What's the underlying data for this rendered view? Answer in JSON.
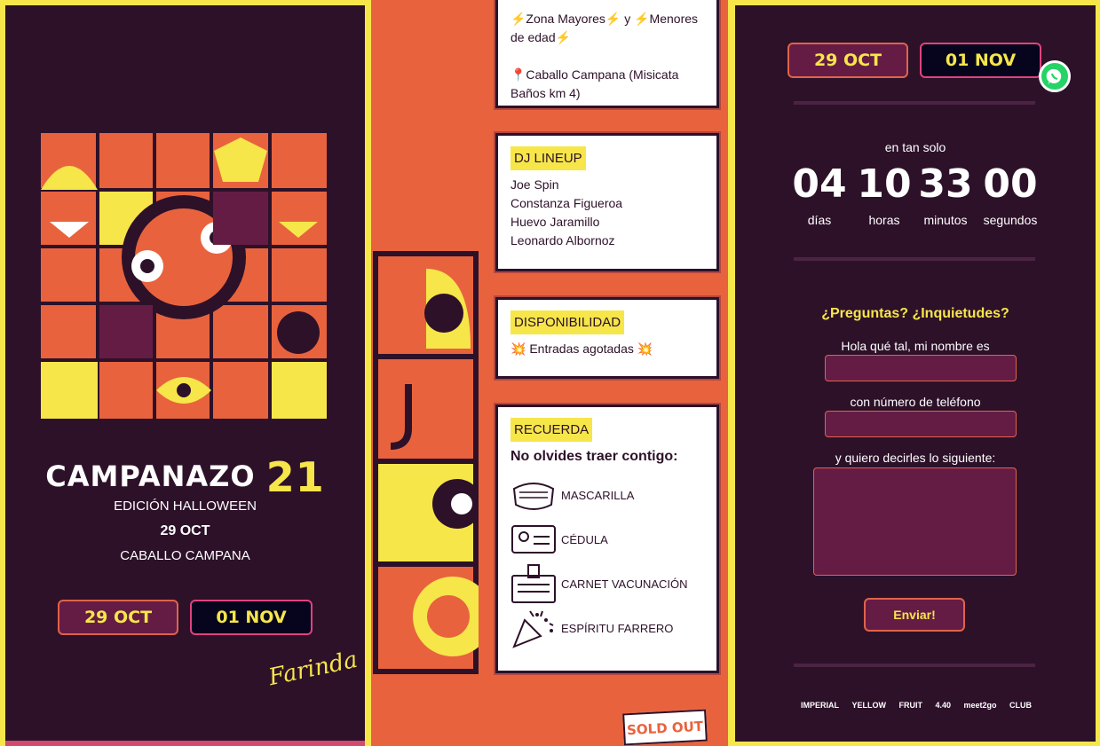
{
  "left": {
    "event_name": "CAMPANAZO",
    "event_number": "21",
    "edition": "EDICIÓN HALLOWEEN",
    "date": "29 OCT",
    "place": "CABALLO CAMPANA",
    "date_buttons": [
      "29 OCT",
      "01 NOV"
    ],
    "signature": "Farinda"
  },
  "info": {
    "zone_text": "⚡Zona Mayores⚡ y ⚡Menores de edad⚡",
    "location_text": "📍Caballo Campana (Misicata Baños km 4)"
  },
  "lineup": {
    "tag": "DJ LINEUP",
    "djs": [
      "Joe Spin",
      "Constanza Figueroa",
      "Huevo Jaramillo",
      "Leonardo Albornoz"
    ]
  },
  "availability": {
    "tag": "DISPONIBILIDAD",
    "text": "💥 Entradas agotadas 💥"
  },
  "reminder": {
    "tag": "RECUERDA",
    "title": "No olvides traer contigo:",
    "items": [
      {
        "label": "MASCARILLA",
        "icon": "mask-icon"
      },
      {
        "label": "CÉDULA",
        "icon": "id-card-icon"
      },
      {
        "label": "CARNET VACUNACIÓN",
        "icon": "vaccination-card-icon"
      },
      {
        "label": "ESPÍRITU FARRERO",
        "icon": "party-popper-icon"
      }
    ]
  },
  "soldout": "SOLD OUT",
  "right": {
    "date_buttons": [
      "29 OCT",
      "01 NOV"
    ],
    "countdown_intro": "en tan solo",
    "countdown": [
      {
        "value": "04",
        "unit": "días"
      },
      {
        "value": "10",
        "unit": "horas"
      },
      {
        "value": "33",
        "unit": "minutos"
      },
      {
        "value": "00",
        "unit": "segundos"
      }
    ],
    "form": {
      "title": "¿Preguntas? ¿Inquietudes?",
      "name_label": "Hola qué tal, mi nombre es",
      "phone_label": "con número de teléfono",
      "message_label": "y quiero decirles lo siguiente:",
      "submit": "Enviar!"
    },
    "sponsors": [
      "IMPERIAL",
      "YELLOW",
      "FRUIT",
      "4.40",
      "meet2go",
      "CLUB"
    ]
  },
  "colors": {
    "dark": "#2d1129",
    "accent": "#f6e64a",
    "orange": "#e8633d",
    "wine": "#651c44"
  }
}
